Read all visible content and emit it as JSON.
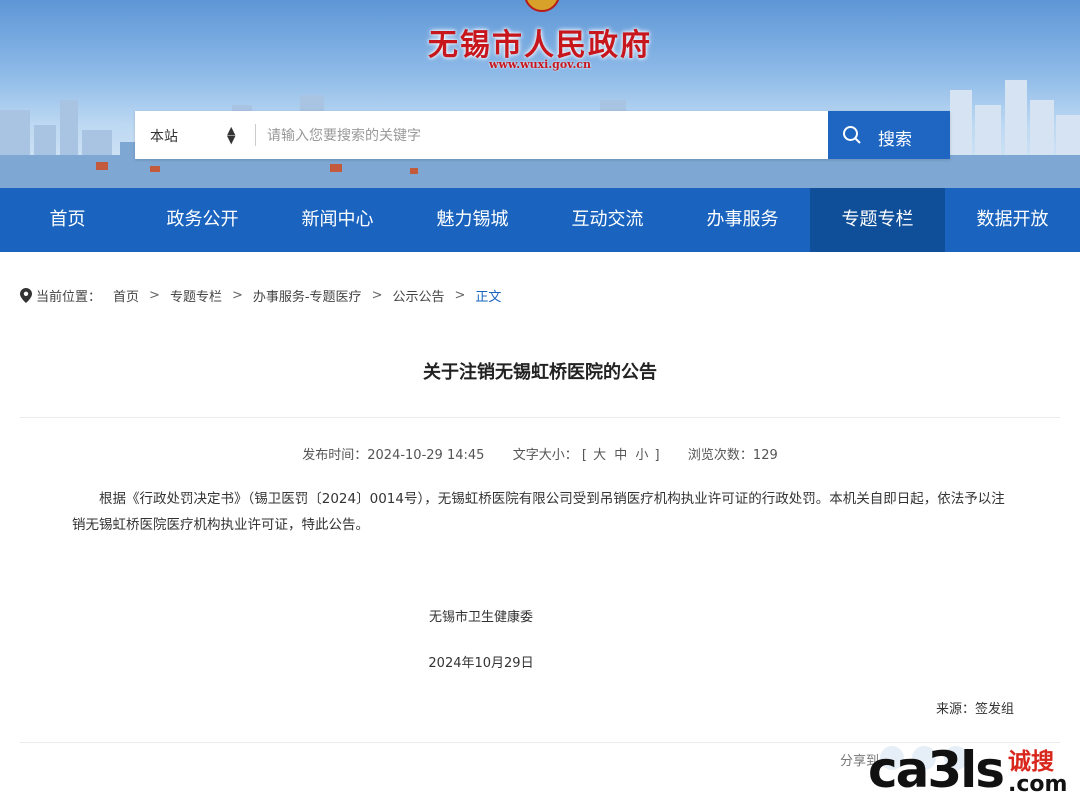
{
  "header": {
    "site_title": "无锡市人民政府",
    "site_url": "www.wuxi.gov.cn"
  },
  "search": {
    "scope": "本站",
    "placeholder": "请输入您要搜索的关键字",
    "button_label": "搜索"
  },
  "nav": {
    "items": [
      {
        "label": "首页"
      },
      {
        "label": "政务公开"
      },
      {
        "label": "新闻中心"
      },
      {
        "label": "魅力锡城"
      },
      {
        "label": "互动交流"
      },
      {
        "label": "办事服务"
      },
      {
        "label": "专题专栏"
      },
      {
        "label": "数据开放"
      }
    ],
    "active_index": 6
  },
  "breadcrumb": {
    "label": "当前位置：",
    "items": [
      "首页",
      "专题专栏",
      "办事服务-专题医疗",
      "公示公告",
      "正文"
    ],
    "separator": ">"
  },
  "article": {
    "title": "关于注销无锡虹桥医院的公告",
    "meta": {
      "publish_label": "发布时间：",
      "publish_time": "2024-10-29 14:45",
      "font_label": "文字大小：",
      "font_open": "[",
      "font_large": "大",
      "font_medium": "中",
      "font_small": "小",
      "font_close": "]",
      "views_label": "浏览次数：",
      "views": "129"
    },
    "body": "根据《行政处罚决定书》（锡卫医罚〔2024〕0014号），无锡虹桥医院有限公司受到吊销医疗机构执业许可证的行政处罚。本机关自即日起，依法予以注销无锡虹桥医院医疗机构执业许可证，特此公告。",
    "signature": "无锡市卫生健康委",
    "date": "2024年10月29日",
    "source": "来源：签发组"
  },
  "share": {
    "label": "分享到"
  },
  "watermark": {
    "logo": "ca3ls",
    "cn": "诚搜",
    "com": ".com"
  },
  "colors": {
    "brand_blue": "#1a64bf",
    "nav_active": "#0f4f9a",
    "title_red": "#c8161d"
  }
}
